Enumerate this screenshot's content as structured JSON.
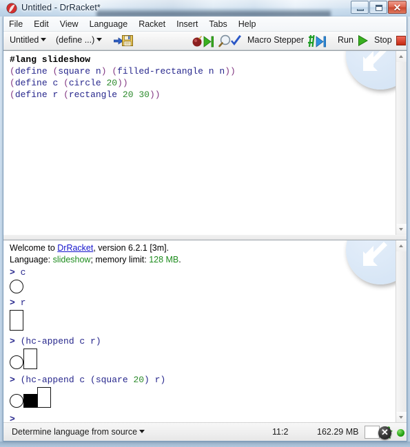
{
  "window": {
    "title": "Untitled - DrRacket*",
    "app_icon": "racket-logo-icon",
    "buttons": {
      "minimize": "minimize-icon",
      "maximize": "maximize-icon",
      "close": "✕"
    }
  },
  "menubar": {
    "items": [
      {
        "label": "File"
      },
      {
        "label": "Edit"
      },
      {
        "label": "View"
      },
      {
        "label": "Language"
      },
      {
        "label": "Racket"
      },
      {
        "label": "Insert"
      },
      {
        "label": "Tabs"
      },
      {
        "label": "Help"
      }
    ]
  },
  "toolbar": {
    "file_name": "Untitled",
    "definitions_selector": "(define ...)",
    "save_icon": "save-disk-icon",
    "arrow_icon": "blue-arrow-icon",
    "debug_label": "debug-icon",
    "check_syntax_label": "check-syntax-icon",
    "macro_stepper_label": "Macro Stepper",
    "macro_stepper_icon": "macro-stepper-icon",
    "run_label": "Run",
    "run_icon": "green-play-icon",
    "stop_label": "Stop",
    "stop_icon": "red-stop-icon"
  },
  "editor": {
    "hint_badge": "drag-arrow-hint-icon",
    "lines": [
      {
        "text": "#lang slideshow"
      },
      {
        "text": "(define (square n) (filled-rectangle n n))"
      },
      {
        "text": "(define c (circle 20))"
      },
      {
        "text": "(define r (rectangle 20 30))"
      }
    ]
  },
  "repl": {
    "hint_badge": "drag-arrow-hint-icon",
    "close_icon": "✕",
    "welcome": {
      "prefix": "Welcome to ",
      "link": "DrRacket",
      "suffix": ", version 6.2.1 [3m]."
    },
    "language_line": {
      "label": "Language: ",
      "language": "slideshow",
      "middle": "; memory limit: ",
      "memory": "128 MB",
      "end": "."
    },
    "entries": [
      {
        "prompt": "> ",
        "expr": "c",
        "result": "circle-20"
      },
      {
        "prompt": "> ",
        "expr": "r",
        "result": "rectangle-20x30"
      },
      {
        "prompt": "> ",
        "expr": "(hc-append c r)",
        "result": "circle-then-rectangle"
      },
      {
        "prompt": "> ",
        "expr": "(hc-append c (square 20) r)",
        "result": "circle-square-rectangle"
      },
      {
        "prompt": "> ",
        "expr": "",
        "result": ""
      }
    ]
  },
  "statusbar": {
    "language_button": "Determine language from source",
    "cursor_position": "11:2",
    "memory_usage": "162.29 MB",
    "runner_icon": "running-person-icon",
    "status_dot": "green-idle-dot"
  },
  "colors": {
    "keyword": "#26268c",
    "number": "#2c8a2c",
    "paren": "#843a84",
    "link": "#1414cc",
    "green_text": "#1e8c1e",
    "stop_red": "#c42a12",
    "run_green": "#23a112"
  }
}
